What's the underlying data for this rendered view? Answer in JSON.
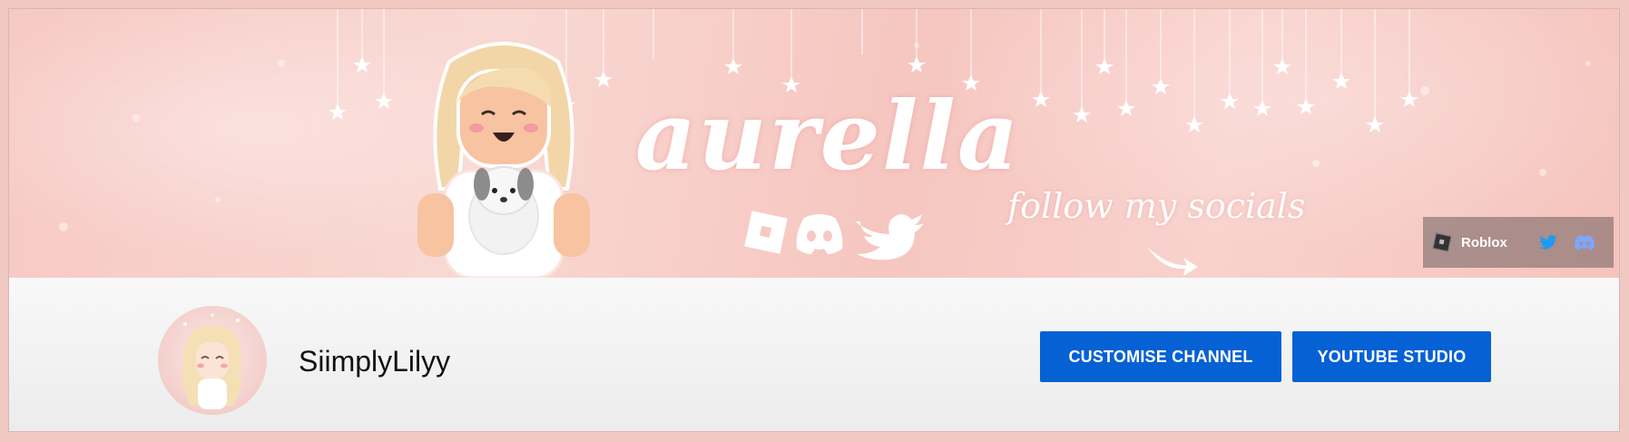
{
  "banner": {
    "title": "aurella",
    "subtitle": "follow my socials",
    "social_icons": [
      "roblox-icon",
      "discord-icon",
      "twitter-icon"
    ]
  },
  "links": [
    {
      "label": "Roblox",
      "icon": "roblox-icon"
    },
    {
      "label": "",
      "icon": "twitter-icon"
    },
    {
      "label": "",
      "icon": "discord-icon"
    }
  ],
  "channel": {
    "name": "SiimplyLilyy",
    "customise_label": "CUSTOMISE CHANNEL",
    "studio_label": "YOUTUBE STUDIO"
  },
  "colors": {
    "primary_button": "#0661d4",
    "banner_pink": "#f7c9c4",
    "page_border": "#f2c9c2"
  }
}
